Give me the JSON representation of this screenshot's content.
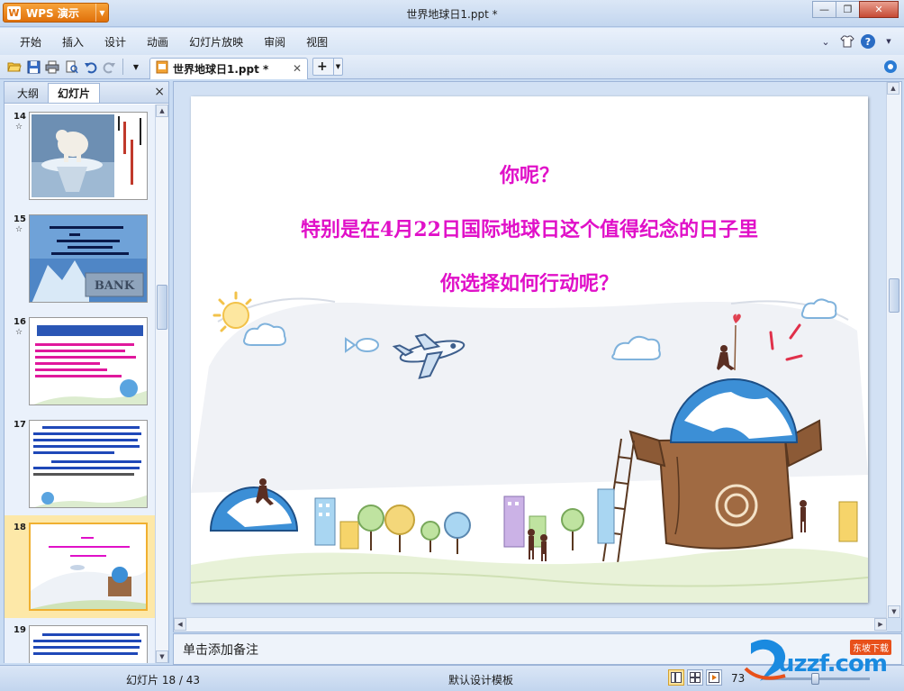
{
  "app": {
    "product_label": "WPS 演示",
    "window_title": "世界地球日1.ppt *"
  },
  "menu": {
    "items": [
      "开始",
      "插入",
      "设计",
      "动画",
      "幻灯片放映",
      "审阅",
      "视图"
    ]
  },
  "toolbar": {
    "document_tab": "世界地球日1.ppt *",
    "new_tab_label": "+"
  },
  "left_panel": {
    "tabs": [
      "大纲",
      "幻灯片"
    ],
    "active_tab": "幻灯片",
    "close_label": "×",
    "thumbnails": [
      {
        "number": "14",
        "star": "☆"
      },
      {
        "number": "15",
        "star": "☆"
      },
      {
        "number": "16",
        "star": "☆"
      },
      {
        "number": "17",
        "star": ""
      },
      {
        "number": "18",
        "star": ""
      },
      {
        "number": "19",
        "star": ""
      }
    ],
    "selected_number": "18",
    "thumb15_sign": "BANK"
  },
  "slide": {
    "line1": "你呢？",
    "line2": "特别是在4月22日国际地球日这个值得纪念的日子里",
    "line3": "你选择如何行动呢？",
    "text_color": "#e010c8"
  },
  "notes": {
    "placeholder": "单击添加备注"
  },
  "status": {
    "slide_counter": "幻灯片 18 / 43",
    "template": "默认设计模板",
    "zoom_partial": "73"
  },
  "watermark": {
    "text": "uzzf.com",
    "badge": "东坡下载"
  },
  "colors": {
    "accent_orange": "#e0700a",
    "selection": "#fde8a8",
    "chrome_blue": "#c9dcf3"
  }
}
